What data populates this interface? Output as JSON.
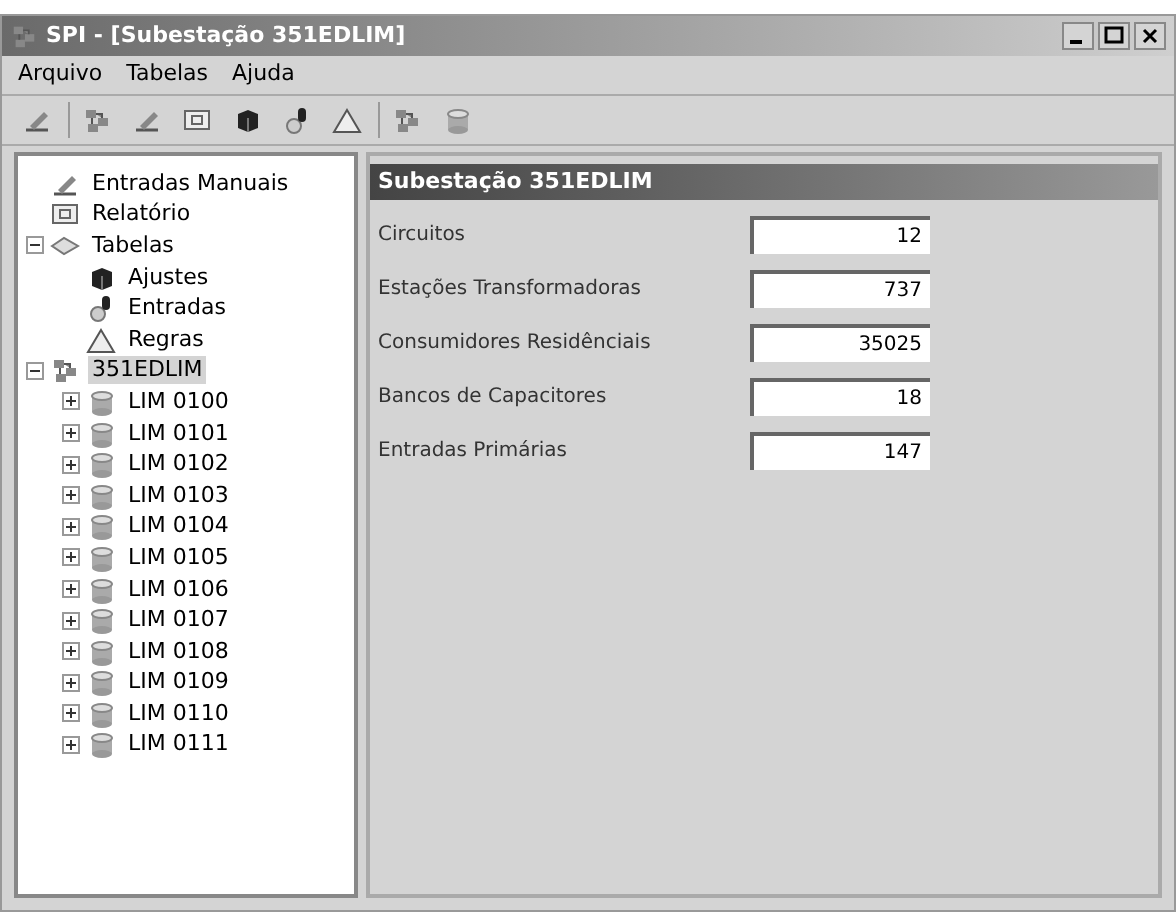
{
  "window": {
    "title": "SPI - [Subestação 351EDLIM]"
  },
  "menu": [
    "Arquivo",
    "Tabelas",
    "Ajuda"
  ],
  "tree": [
    {
      "label": "Entradas Manuais",
      "kind": "pen",
      "selected": false
    },
    {
      "label": "Relatório",
      "kind": "report",
      "selected": false
    },
    {
      "label": "Tabelas",
      "kind": "tables",
      "selected": false,
      "expanded": true,
      "children": [
        {
          "label": "Ajustes",
          "kind": "cube",
          "selected": false
        },
        {
          "label": "Entradas",
          "kind": "plug",
          "selected": false
        },
        {
          "label": "Regras",
          "kind": "triangle",
          "selected": false
        }
      ]
    },
    {
      "label": "351EDLIM",
      "kind": "network",
      "selected": true,
      "expanded": true,
      "children": [
        {
          "label": "LIM 0100",
          "kind": "cylinder",
          "selected": false,
          "expanded": false
        },
        {
          "label": "LIM 0101",
          "kind": "cylinder",
          "selected": false,
          "expanded": false
        },
        {
          "label": "LIM 0102",
          "kind": "cylinder",
          "selected": false,
          "expanded": false
        },
        {
          "label": "LIM 0103",
          "kind": "cylinder",
          "selected": false,
          "expanded": false
        },
        {
          "label": "LIM 0104",
          "kind": "cylinder",
          "selected": false,
          "expanded": false
        },
        {
          "label": "LIM 0105",
          "kind": "cylinder",
          "selected": false,
          "expanded": false
        },
        {
          "label": "LIM 0106",
          "kind": "cylinder",
          "selected": false,
          "expanded": false
        },
        {
          "label": "LIM 0107",
          "kind": "cylinder",
          "selected": false,
          "expanded": false
        },
        {
          "label": "LIM 0108",
          "kind": "cylinder",
          "selected": false,
          "expanded": false
        },
        {
          "label": "LIM 0109",
          "kind": "cylinder",
          "selected": false,
          "expanded": false
        },
        {
          "label": "LIM 0110",
          "kind": "cylinder",
          "selected": false,
          "expanded": false
        },
        {
          "label": "LIM 0111",
          "kind": "cylinder",
          "selected": false,
          "expanded": false
        }
      ]
    }
  ],
  "panel": {
    "title": "Subestação 351EDLIM",
    "fields": [
      {
        "label": "Circuitos",
        "value": "12"
      },
      {
        "label": "Estações Transformadoras",
        "value": "737"
      },
      {
        "label": "Consumidores Residênciais",
        "value": "35025"
      },
      {
        "label": "Bancos de Capacitores",
        "value": "18"
      },
      {
        "label": "Entradas Primárias",
        "value": "147"
      }
    ]
  }
}
